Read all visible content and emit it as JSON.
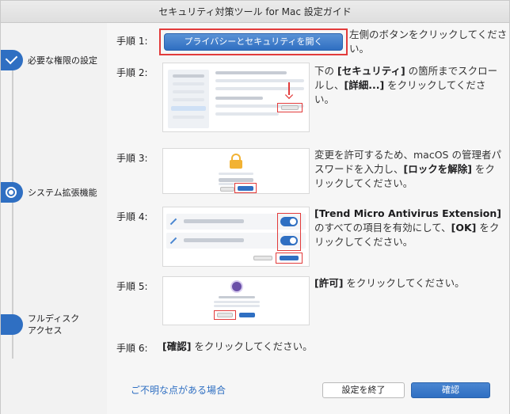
{
  "window": {
    "title": "セキュリティ対策ツール for Mac 設定ガイド"
  },
  "sidebar": {
    "steps": [
      {
        "label": "必要な権限の設定",
        "state": "completed"
      },
      {
        "label": "システム拡張機能",
        "state": "current"
      },
      {
        "label": "フルディスク\nアクセス",
        "state": "pending"
      }
    ]
  },
  "steps": [
    {
      "label": "手順 1:",
      "button": "プライバシーとセキュリティを開く",
      "description": "左側のボタンをクリックしてください。"
    },
    {
      "label": "手順 2:",
      "desc_before": "下の ",
      "desc_bold1": "[セキュリティ]",
      "desc_mid": " の箇所までスクロールし、",
      "desc_bold2": "[詳細...]",
      "desc_after": " をクリックしてください。"
    },
    {
      "label": "手順 3:",
      "desc_before": "変更を許可するため、macOS の管理者パスワードを入力し、",
      "desc_bold1": "[ロックを解除]",
      "desc_after": " をクリックしてください。"
    },
    {
      "label": "手順 4:",
      "desc_bold1": "[Trend Micro Antivirus Extension]",
      "desc_mid": " のすべての項目を有効にして、",
      "desc_bold2": "[OK]",
      "desc_after": " をクリックしてください。"
    },
    {
      "label": "手順 5:",
      "desc_bold1": "[許可]",
      "desc_after": " をクリックしてください。"
    },
    {
      "label": "手順 6:",
      "desc_bold1": "[確認]",
      "desc_after": " をクリックしてください。"
    }
  ],
  "footer": {
    "help_link": "ご不明な点がある場合",
    "end_button": "設定を終了",
    "confirm_button": "確認"
  },
  "colors": {
    "accent": "#2f6fc2",
    "highlight": "#e23b3b"
  }
}
